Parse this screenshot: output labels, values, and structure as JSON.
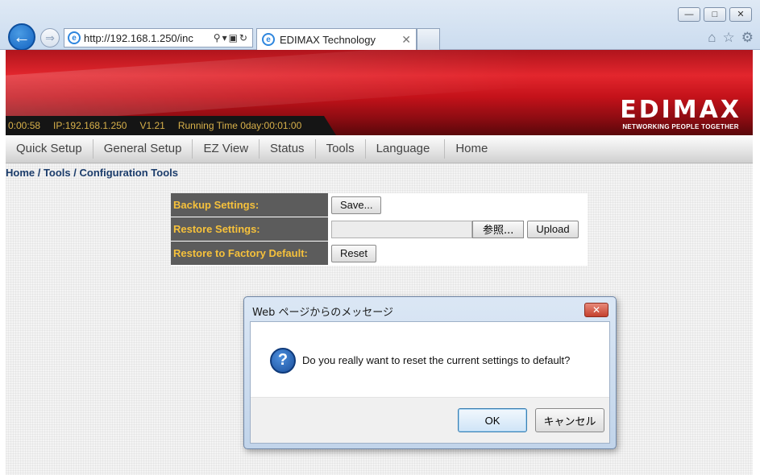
{
  "browser": {
    "address_url": "http://192.168.1.250/inc",
    "tab_title": "EDIMAX Technology"
  },
  "banner": {
    "clock": "0:00:58",
    "ip": "IP:192.168.1.250",
    "version": "V1.21",
    "running_time": "Running Time 0day:00:01:00",
    "brand_name": "EDIMAX",
    "brand_tagline": "NETWORKING PEOPLE TOGETHER"
  },
  "nav": {
    "items": [
      "Quick Setup",
      "General Setup",
      "EZ View",
      "Status",
      "Tools",
      "Language",
      "Home"
    ]
  },
  "breadcrumb": "Home / Tools / Configuration Tools",
  "config": {
    "backup_label": "Backup Settings:",
    "save_button": "Save...",
    "restore_label": "Restore Settings:",
    "browse_button": "参照...",
    "upload_button": "Upload",
    "factory_label": "Restore to Factory Default:",
    "reset_button": "Reset"
  },
  "dialog": {
    "title": "Web ページからのメッセージ",
    "message": "Do you really want to reset the current settings to default?",
    "ok_button": "OK",
    "cancel_button": "キャンセル"
  }
}
